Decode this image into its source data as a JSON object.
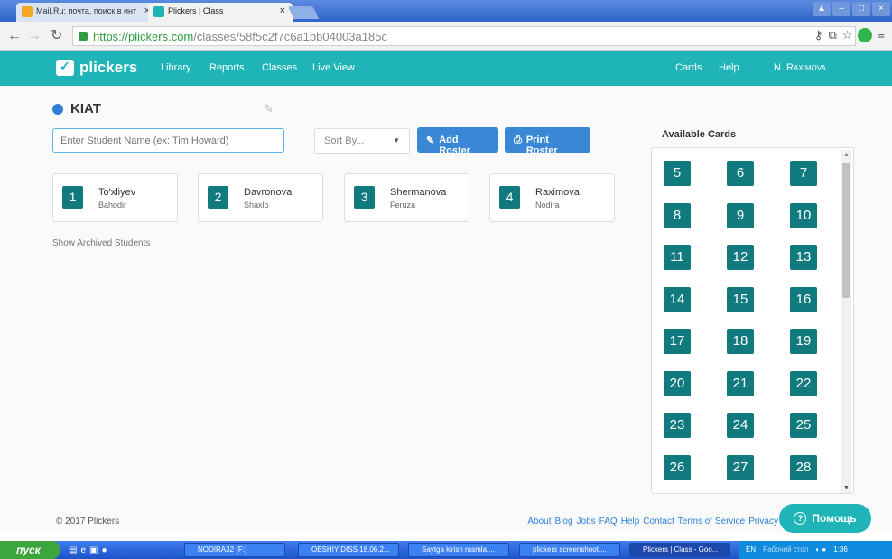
{
  "browser": {
    "tabs": [
      {
        "label": "Mail.Ru: почта, поиск в инт"
      },
      {
        "label": "Plickers | Class"
      }
    ],
    "url_host": "https://plickers.com",
    "url_path": "/classes/58f5c2f7c6a1bb04003a185c"
  },
  "header": {
    "logo": "plickers",
    "nav": [
      "Library",
      "Reports",
      "Classes",
      "Live View"
    ],
    "right_nav": [
      "Cards",
      "Help",
      "N. Raximova"
    ]
  },
  "class": {
    "title": "KIAT",
    "search_placeholder": "Enter Student Name (ex: Tim Howard)",
    "sort_label": "Sort By...",
    "add_roster": "Add Roster",
    "print_roster": "Print Roster",
    "show_archived": "Show Archived Students"
  },
  "students": [
    {
      "num": "1",
      "first": "To'xliyev",
      "last": "Bahodir"
    },
    {
      "num": "2",
      "first": "Davronova",
      "last": "Shaxlo"
    },
    {
      "num": "3",
      "first": "Shermanova",
      "last": "Feruza"
    },
    {
      "num": "4",
      "first": "Raximova",
      "last": "Nodira"
    }
  ],
  "cards": {
    "title": "Available Cards",
    "numbers": [
      "5",
      "6",
      "7",
      "8",
      "9",
      "10",
      "11",
      "12",
      "13",
      "14",
      "15",
      "16",
      "17",
      "18",
      "19",
      "20",
      "21",
      "22",
      "23",
      "24",
      "25",
      "26",
      "27",
      "28"
    ]
  },
  "footer": {
    "copyright": "© 2017 Plickers",
    "links": [
      "About",
      "Blog",
      "Jobs",
      "FAQ",
      "Help",
      "Contact",
      "Terms of Service",
      "Privacy"
    ],
    "help_button": "Помощь"
  },
  "taskbar": {
    "start": "пуск",
    "tasks": [
      "NODIRA32 (F:)",
      "OBSHIY DISS 18.06.2...",
      "Saytga kirish rasmla....",
      "plickers screenshoot....",
      "Plickers | Class - Goo..."
    ],
    "lang": "EN",
    "desktop": "Рабочий стол",
    "time": "1:36"
  },
  "colors": {
    "teal": "#1eb4b8",
    "card_dark_teal": "#117a7f",
    "button_blue": "#3a87d6"
  }
}
